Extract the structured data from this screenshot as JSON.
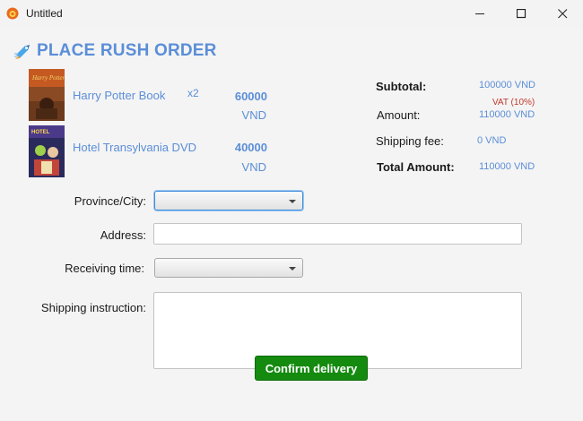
{
  "window": {
    "title": "Untitled"
  },
  "header": {
    "title": "PLACE RUSH ORDER"
  },
  "items": [
    {
      "name": "Harry Potter Book",
      "qty": "x2",
      "price": "60000",
      "currency": "VND"
    },
    {
      "name": "Hotel Transylvania DVD",
      "qty": "",
      "price": "40000",
      "currency": "VND"
    }
  ],
  "summary": {
    "subtotal_label": "Subtotal:",
    "subtotal_value": "100000 VND",
    "vat_label": "VAT (10%)",
    "amount_label": "Amount:",
    "amount_value": "110000 VND",
    "shipping_label": "Shipping fee:",
    "shipping_value": "0 VND",
    "total_label": "Total Amount:",
    "total_value": "110000 VND"
  },
  "form": {
    "province_label": "Province/City:",
    "province_value": "",
    "address_label": "Address:",
    "address_value": "",
    "time_label": "Receiving time:",
    "time_value": "",
    "instruction_label": "Shipping instruction:",
    "instruction_value": ""
  },
  "actions": {
    "confirm_label": "Confirm delivery"
  },
  "colors": {
    "accent": "#5b8ed8",
    "vat": "#c0392b",
    "confirm": "#148a0f"
  }
}
